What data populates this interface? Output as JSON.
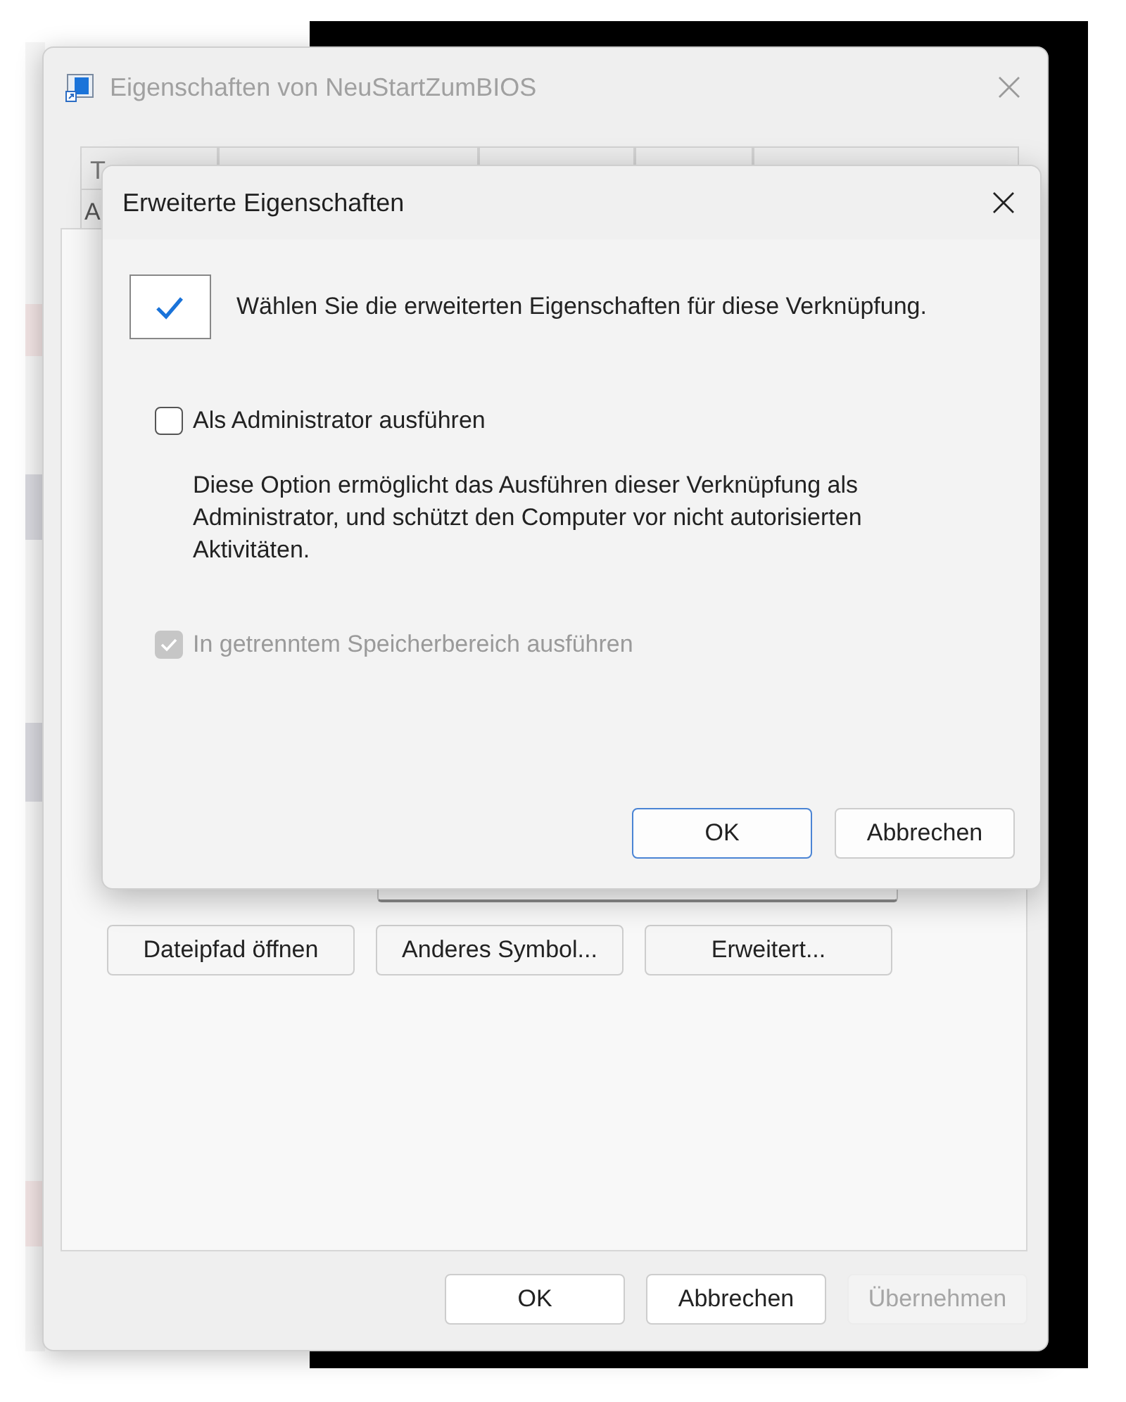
{
  "background_window": {
    "title": "Eigenschaften von NeuStartZumBIOS",
    "tab_rows": [
      {
        "tabs": [
          {
            "kind": "labeled",
            "label": "T"
          },
          {
            "kind": "covered"
          },
          {
            "kind": "covered"
          },
          {
            "kind": "covered"
          },
          {
            "kind": "covered"
          }
        ]
      },
      {
        "tabs": [
          {
            "kind": "labeled",
            "label": "A"
          }
        ]
      }
    ],
    "content_buttons": [
      {
        "label": "Dateipfad öffnen"
      },
      {
        "label": "Anderes Symbol..."
      },
      {
        "label": "Erweitert..."
      }
    ],
    "footer_buttons": [
      {
        "label": "OK",
        "disabled": false
      },
      {
        "label": "Abbrechen",
        "disabled": false
      },
      {
        "label": "Übernehmen",
        "disabled": true
      }
    ]
  },
  "dialog": {
    "title": "Erweiterte Eigenschaften",
    "intro": "Wählen Sie die erweiterten Eigenschaften für diese Verknüpfung.",
    "options": [
      {
        "label": "Als Administrator ausführen",
        "checked": false,
        "disabled": false,
        "description": "Diese Option ermöglicht das Ausführen dieser Verknüpfung als Administrator, und schützt den Computer vor nicht autorisierten Aktivitäten."
      },
      {
        "label": "In getrenntem Speicherbereich ausführen",
        "checked": true,
        "disabled": true
      }
    ],
    "buttons": [
      {
        "label": "OK",
        "default": true
      },
      {
        "label": "Abbrechen",
        "default": false
      }
    ]
  }
}
